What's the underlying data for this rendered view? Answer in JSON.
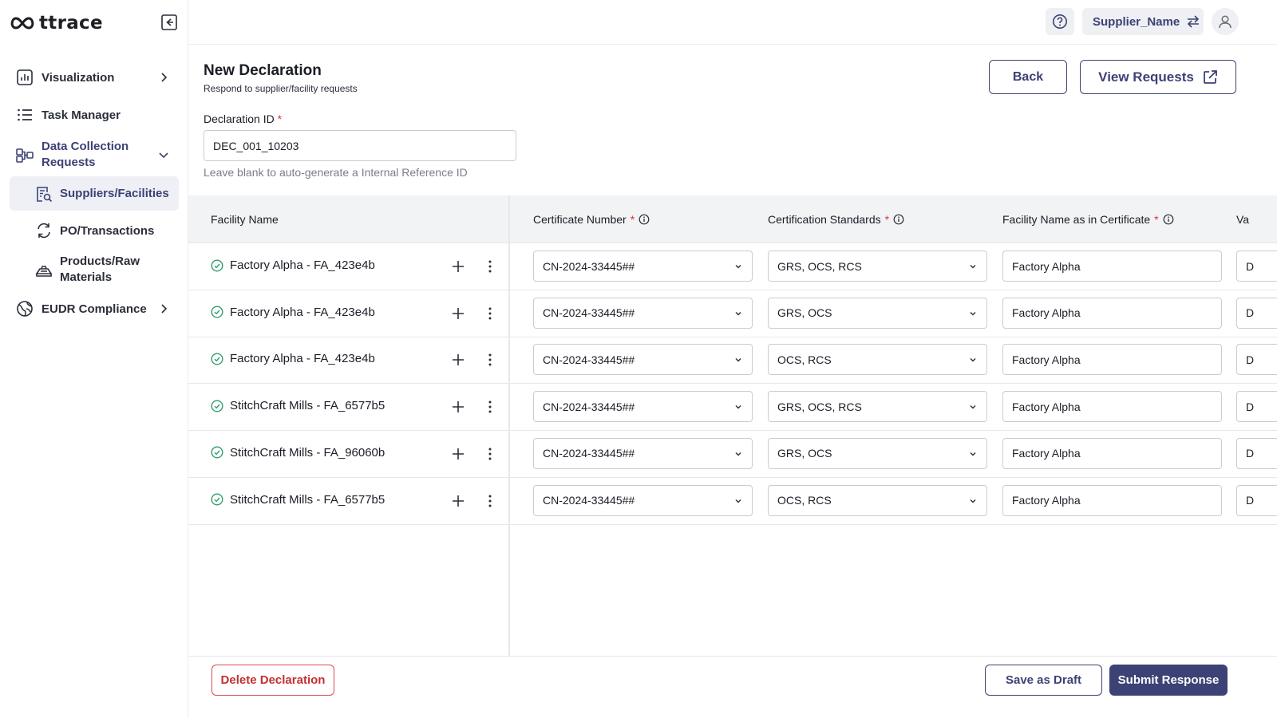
{
  "app": {
    "logo_text": "ttrace"
  },
  "sidebar": {
    "items": [
      {
        "label": "Visualization",
        "icon": "bar-chart-icon"
      },
      {
        "label": "Task Manager",
        "icon": "list-icon"
      },
      {
        "label": "Data Collection Requests",
        "icon": "workflow-icon"
      },
      {
        "label": "EUDR Compliance",
        "icon": "globe-icon"
      }
    ],
    "subitems": [
      {
        "label": "Suppliers/Facilities",
        "icon": "document-search-icon",
        "selected": true
      },
      {
        "label": "PO/Transactions",
        "icon": "refresh-icon"
      },
      {
        "label": "Products/Raw Materials",
        "icon": "layers-icon"
      }
    ]
  },
  "topbar": {
    "supplier_name": "Supplier_Name"
  },
  "header": {
    "title": "New Declaration",
    "subtitle": "Respond to supplier/facility requests",
    "back_label": "Back",
    "view_requests_label": "View Requests"
  },
  "declaration": {
    "label": "Declaration ID",
    "required_mark": "*",
    "value": "DEC_001_10203",
    "hint": "Leave blank to auto-generate a Internal Reference ID"
  },
  "table": {
    "columns": {
      "facility": "Facility Name",
      "certificate": "Certificate Number",
      "standards": "Certification Standards",
      "facility_cert": "Facility Name as in Certificate",
      "partial": "Va"
    },
    "rows": [
      {
        "facility": "Factory Alpha - FA_423e4b",
        "certificate": "CN-2024-33445##",
        "standards": "GRS, OCS, RCS",
        "facility_cert": "Factory Alpha",
        "partial": "D"
      },
      {
        "facility": "Factory Alpha - FA_423e4b",
        "certificate": "CN-2024-33445##",
        "standards": "GRS, OCS",
        "facility_cert": "Factory Alpha",
        "partial": "D"
      },
      {
        "facility": "Factory Alpha - FA_423e4b",
        "certificate": "CN-2024-33445##",
        "standards": "OCS, RCS",
        "facility_cert": "Factory Alpha",
        "partial": "D"
      },
      {
        "facility": "StitchCraft Mills - FA_6577b5",
        "certificate": "CN-2024-33445##",
        "standards": "GRS, OCS, RCS",
        "facility_cert": "Factory Alpha",
        "partial": "D"
      },
      {
        "facility": "StitchCraft Mills - FA_96060b",
        "certificate": "CN-2024-33445##",
        "standards": "GRS, OCS",
        "facility_cert": "Factory Alpha",
        "partial": "D"
      },
      {
        "facility": "StitchCraft Mills - FA_6577b5",
        "certificate": "CN-2024-33445##",
        "standards": "OCS, RCS",
        "facility_cert": "Factory Alpha",
        "partial": "D"
      }
    ]
  },
  "footer": {
    "delete_label": "Delete Declaration",
    "draft_label": "Save as Draft",
    "submit_label": "Submit Response"
  },
  "colors": {
    "accent": "#3c4275",
    "danger": "#c23030",
    "success": "#2e9e6b"
  }
}
